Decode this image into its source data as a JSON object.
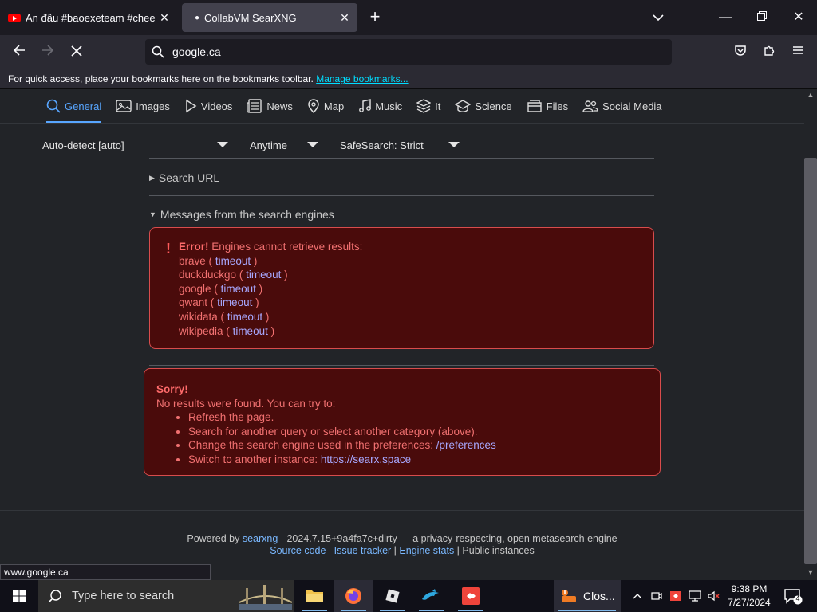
{
  "browser": {
    "tabs": [
      {
        "title": "An đầu #baoexeteam #cheems",
        "icon": "youtube-icon",
        "active": false
      },
      {
        "title": "CollabVM SearXNG",
        "icon": "loading-dot",
        "active": true
      }
    ],
    "url": "google.ca",
    "bookmarks_hint": "For quick access, place your bookmarks here on the bookmarks toolbar.",
    "manage_bookmarks": "Manage bookmarks...",
    "status_url": "www.google.ca"
  },
  "searxng": {
    "categories": [
      {
        "label": "General",
        "icon": "search-icon",
        "active": true
      },
      {
        "label": "Images",
        "icon": "image-icon"
      },
      {
        "label": "Videos",
        "icon": "play-icon"
      },
      {
        "label": "News",
        "icon": "newspaper-icon"
      },
      {
        "label": "Map",
        "icon": "map-pin-icon"
      },
      {
        "label": "Music",
        "icon": "music-icon"
      },
      {
        "label": "It",
        "icon": "layers-icon"
      },
      {
        "label": "Science",
        "icon": "graduation-cap-icon"
      },
      {
        "label": "Files",
        "icon": "files-icon"
      },
      {
        "label": "Social Media",
        "icon": "people-icon"
      }
    ],
    "filters": {
      "language": "Auto-detect [auto]",
      "time": "Anytime",
      "safesearch": "SafeSearch: Strict"
    },
    "search_url_label": "Search URL",
    "messages_label": "Messages from the search engines",
    "error": {
      "title": "Error!",
      "message": "Engines cannot retrieve results:",
      "engines": [
        {
          "name": "brave",
          "reason": "timeout"
        },
        {
          "name": "duckduckgo",
          "reason": "timeout"
        },
        {
          "name": "google",
          "reason": "timeout"
        },
        {
          "name": "qwant",
          "reason": "timeout"
        },
        {
          "name": "wikidata",
          "reason": "timeout"
        },
        {
          "name": "wikipedia",
          "reason": "timeout"
        }
      ]
    },
    "sorry": {
      "title": "Sorry!",
      "message": "No results were found. You can try to:",
      "items": [
        {
          "text": "Refresh the page.",
          "link": ""
        },
        {
          "text": "Search for another query or select another category (above).",
          "link": ""
        },
        {
          "text": "Change the search engine used in the preferences: ",
          "link": "/preferences"
        },
        {
          "text": "Switch to another instance: ",
          "link": "https://searx.space"
        }
      ]
    },
    "footer": {
      "powered_by": "Powered by",
      "searxng": "searxng",
      "version_text": "- 2024.7.15+9a4fa7c+dirty — a privacy-respecting, open metasearch engine",
      "links": [
        "Source code",
        "Issue tracker",
        "Engine stats",
        "Public instances"
      ]
    }
  },
  "taskbar": {
    "search_placeholder": "Type here to search",
    "apps": [
      "file-explorer-icon",
      "firefox-icon",
      "roblox-icon",
      "dolphin-icon",
      "anydesk-icon"
    ],
    "closing_app_label": "Clos...",
    "notification_count": "4",
    "time": "9:38 PM",
    "date": "7/27/2024"
  },
  "colors": {
    "accent_blue": "#58a6ff",
    "error_bg": "#4a0b0b",
    "error_border": "#d94c4c",
    "error_text": "#f27171",
    "link_text": "#a8a8ff"
  }
}
